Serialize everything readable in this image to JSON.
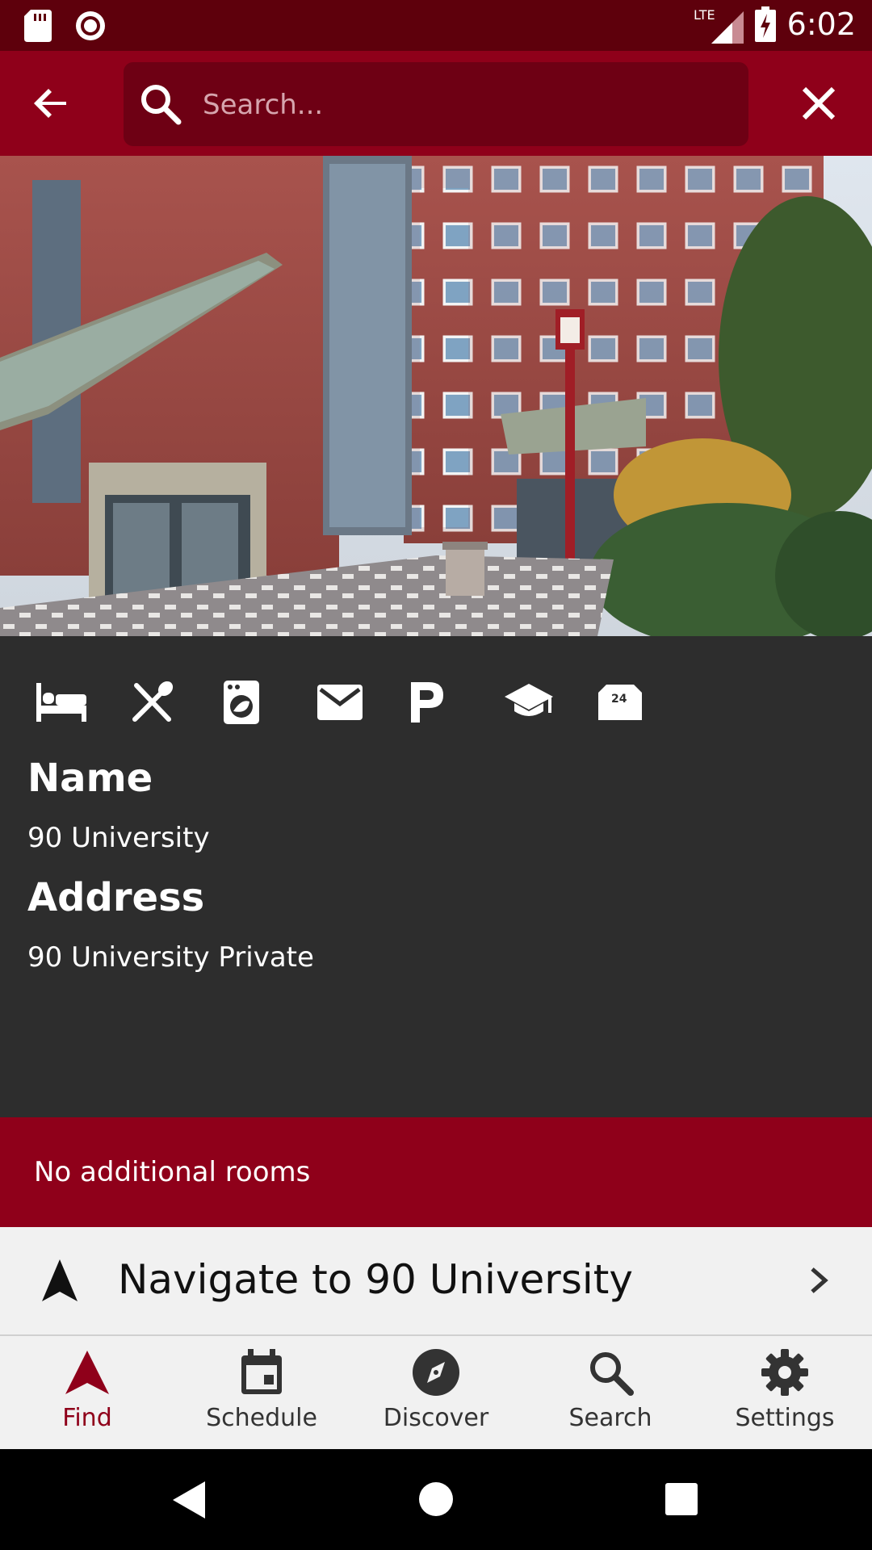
{
  "status_bar": {
    "time": "6:02",
    "network": "LTE",
    "icons": [
      "sd-card-icon",
      "record-icon",
      "signal-icon",
      "battery-charging-icon"
    ]
  },
  "app_bar": {
    "search_placeholder": "Search...",
    "back_icon": "arrow-back-icon",
    "close_icon": "close-icon"
  },
  "amenities": [
    {
      "name": "bed-icon"
    },
    {
      "name": "utensils-icon"
    },
    {
      "name": "laundry-icon"
    },
    {
      "name": "mail-icon"
    },
    {
      "name": "parking-icon"
    },
    {
      "name": "school-icon"
    },
    {
      "name": "24-hour-icon"
    }
  ],
  "info": {
    "name_label": "Name",
    "name_value": "90 University",
    "address_label": "Address",
    "address_value": "90 University Private"
  },
  "rooms": {
    "text": "No additional rooms"
  },
  "navigate": {
    "label": "Navigate to 90 University"
  },
  "bottom_nav": {
    "items": [
      {
        "label": "Find",
        "icon": "find-icon",
        "active": true
      },
      {
        "label": "Schedule",
        "icon": "calendar-icon",
        "active": false
      },
      {
        "label": "Discover",
        "icon": "compass-icon",
        "active": false
      },
      {
        "label": "Search",
        "icon": "search-icon",
        "active": false
      },
      {
        "label": "Settings",
        "icon": "gear-icon",
        "active": false
      }
    ]
  },
  "colors": {
    "primary": "#8f001a",
    "primary_dark": "#5e000c",
    "panel": "#2d2d2d",
    "nav_bg": "#f1f1f1"
  }
}
